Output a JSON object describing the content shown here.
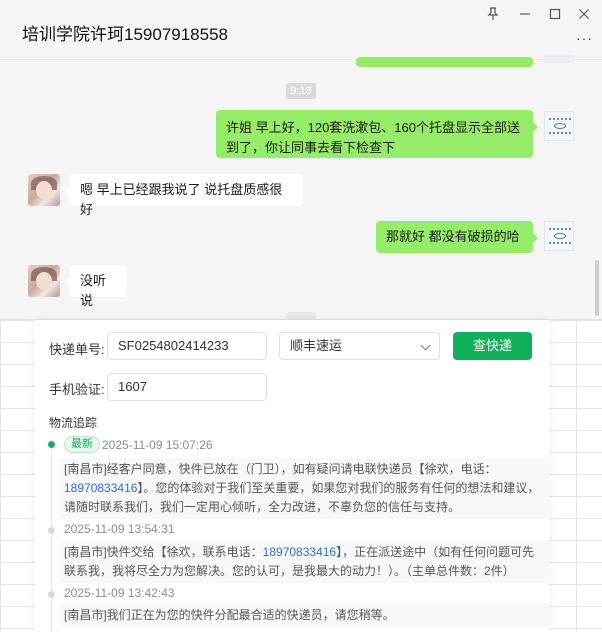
{
  "window": {
    "title": "培训学院许珂15907918558",
    "controls": [
      "pin-icon",
      "minimize-icon",
      "maximize-icon",
      "close-icon"
    ],
    "more_label": "···"
  },
  "chat": {
    "time_divider": "9:18",
    "messages": [
      {
        "from": "me",
        "text": "许姐 早上好，120套洗漱包、160个托盘显示全部送到了，你让同事去看下检查下"
      },
      {
        "from": "other",
        "text": "嗯 早上已经跟我说了 说托盘质感很好"
      },
      {
        "from": "me",
        "text": "那就好  都没有破损的哈"
      },
      {
        "from": "other",
        "text": "没听说"
      }
    ]
  },
  "tracker": {
    "tracking_label": "快递单号:",
    "tracking_value": "SF0254802414233",
    "carrier_value": "顺丰速运",
    "query_button": "查快递",
    "phone_label": "手机验证:",
    "phone_value": "1607",
    "section_title": "物流追踪",
    "events": [
      {
        "badge": "最新",
        "time": "2025-11-09 15:07:26",
        "desc_a": "[南昌市]经客户同意，快件已放在（门卫），如有疑问请电联快递员【徐欢，电话：",
        "phone": "18970833416",
        "desc_b": "】。您的体验对于我们至关重要，如果您对我们的服务有任何的想法和建议，请随时联系我们，我们一定用心倾听，全力改进，不辜负您的信任与支持。"
      },
      {
        "badge": "",
        "time": "2025-11-09 13:54:31",
        "desc_a": "[南昌市]快件交给【徐欢，联系电话：",
        "phone": "18970833416",
        "desc_b": "】，正在派送途中（如有任何问题可先联系我，我将尽全力为您解决。您的认可，是我最大的动力！）。（主单总件数：2件）"
      },
      {
        "badge": "",
        "time": "2025-11-09 13:42:43",
        "desc_a": "[南昌市]我们正在为您的快件分配最合适的快递员，请您稍等。",
        "phone": "",
        "desc_b": ""
      }
    ]
  },
  "colors": {
    "bubble_out": "#95ec69",
    "bubble_in": "#ffffff",
    "accent_green": "#11b05a",
    "phone_link": "#2f6ebd"
  }
}
